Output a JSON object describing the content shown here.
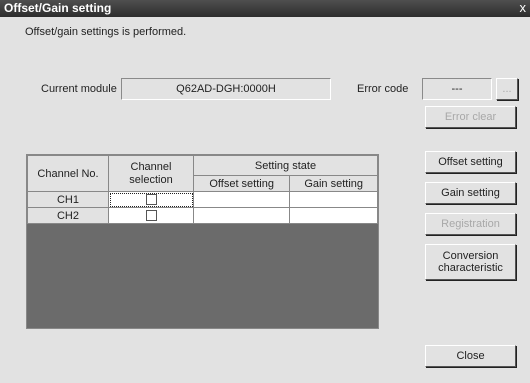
{
  "window": {
    "title": "Offset/Gain setting",
    "close_glyph": "x"
  },
  "description": "Offset/gain settings is performed.",
  "module": {
    "label": "Current module",
    "value": "Q62AD-DGH:0000H"
  },
  "error": {
    "label": "Error code",
    "value": "---",
    "browse_label": "...",
    "clear_label": "Error clear"
  },
  "table": {
    "headers": {
      "channel_no": "Channel No.",
      "channel_selection": "Channel selection",
      "setting_state": "Setting state",
      "offset": "Offset setting",
      "gain": "Gain setting"
    },
    "rows": [
      {
        "channel": "CH1",
        "selected": false,
        "offset": "",
        "gain": ""
      },
      {
        "channel": "CH2",
        "selected": false,
        "offset": "",
        "gain": ""
      }
    ]
  },
  "buttons": {
    "offset_setting": "Offset setting",
    "gain_setting": "Gain setting",
    "registration": "Registration",
    "conversion": "Conversion characteristic",
    "close": "Close"
  }
}
